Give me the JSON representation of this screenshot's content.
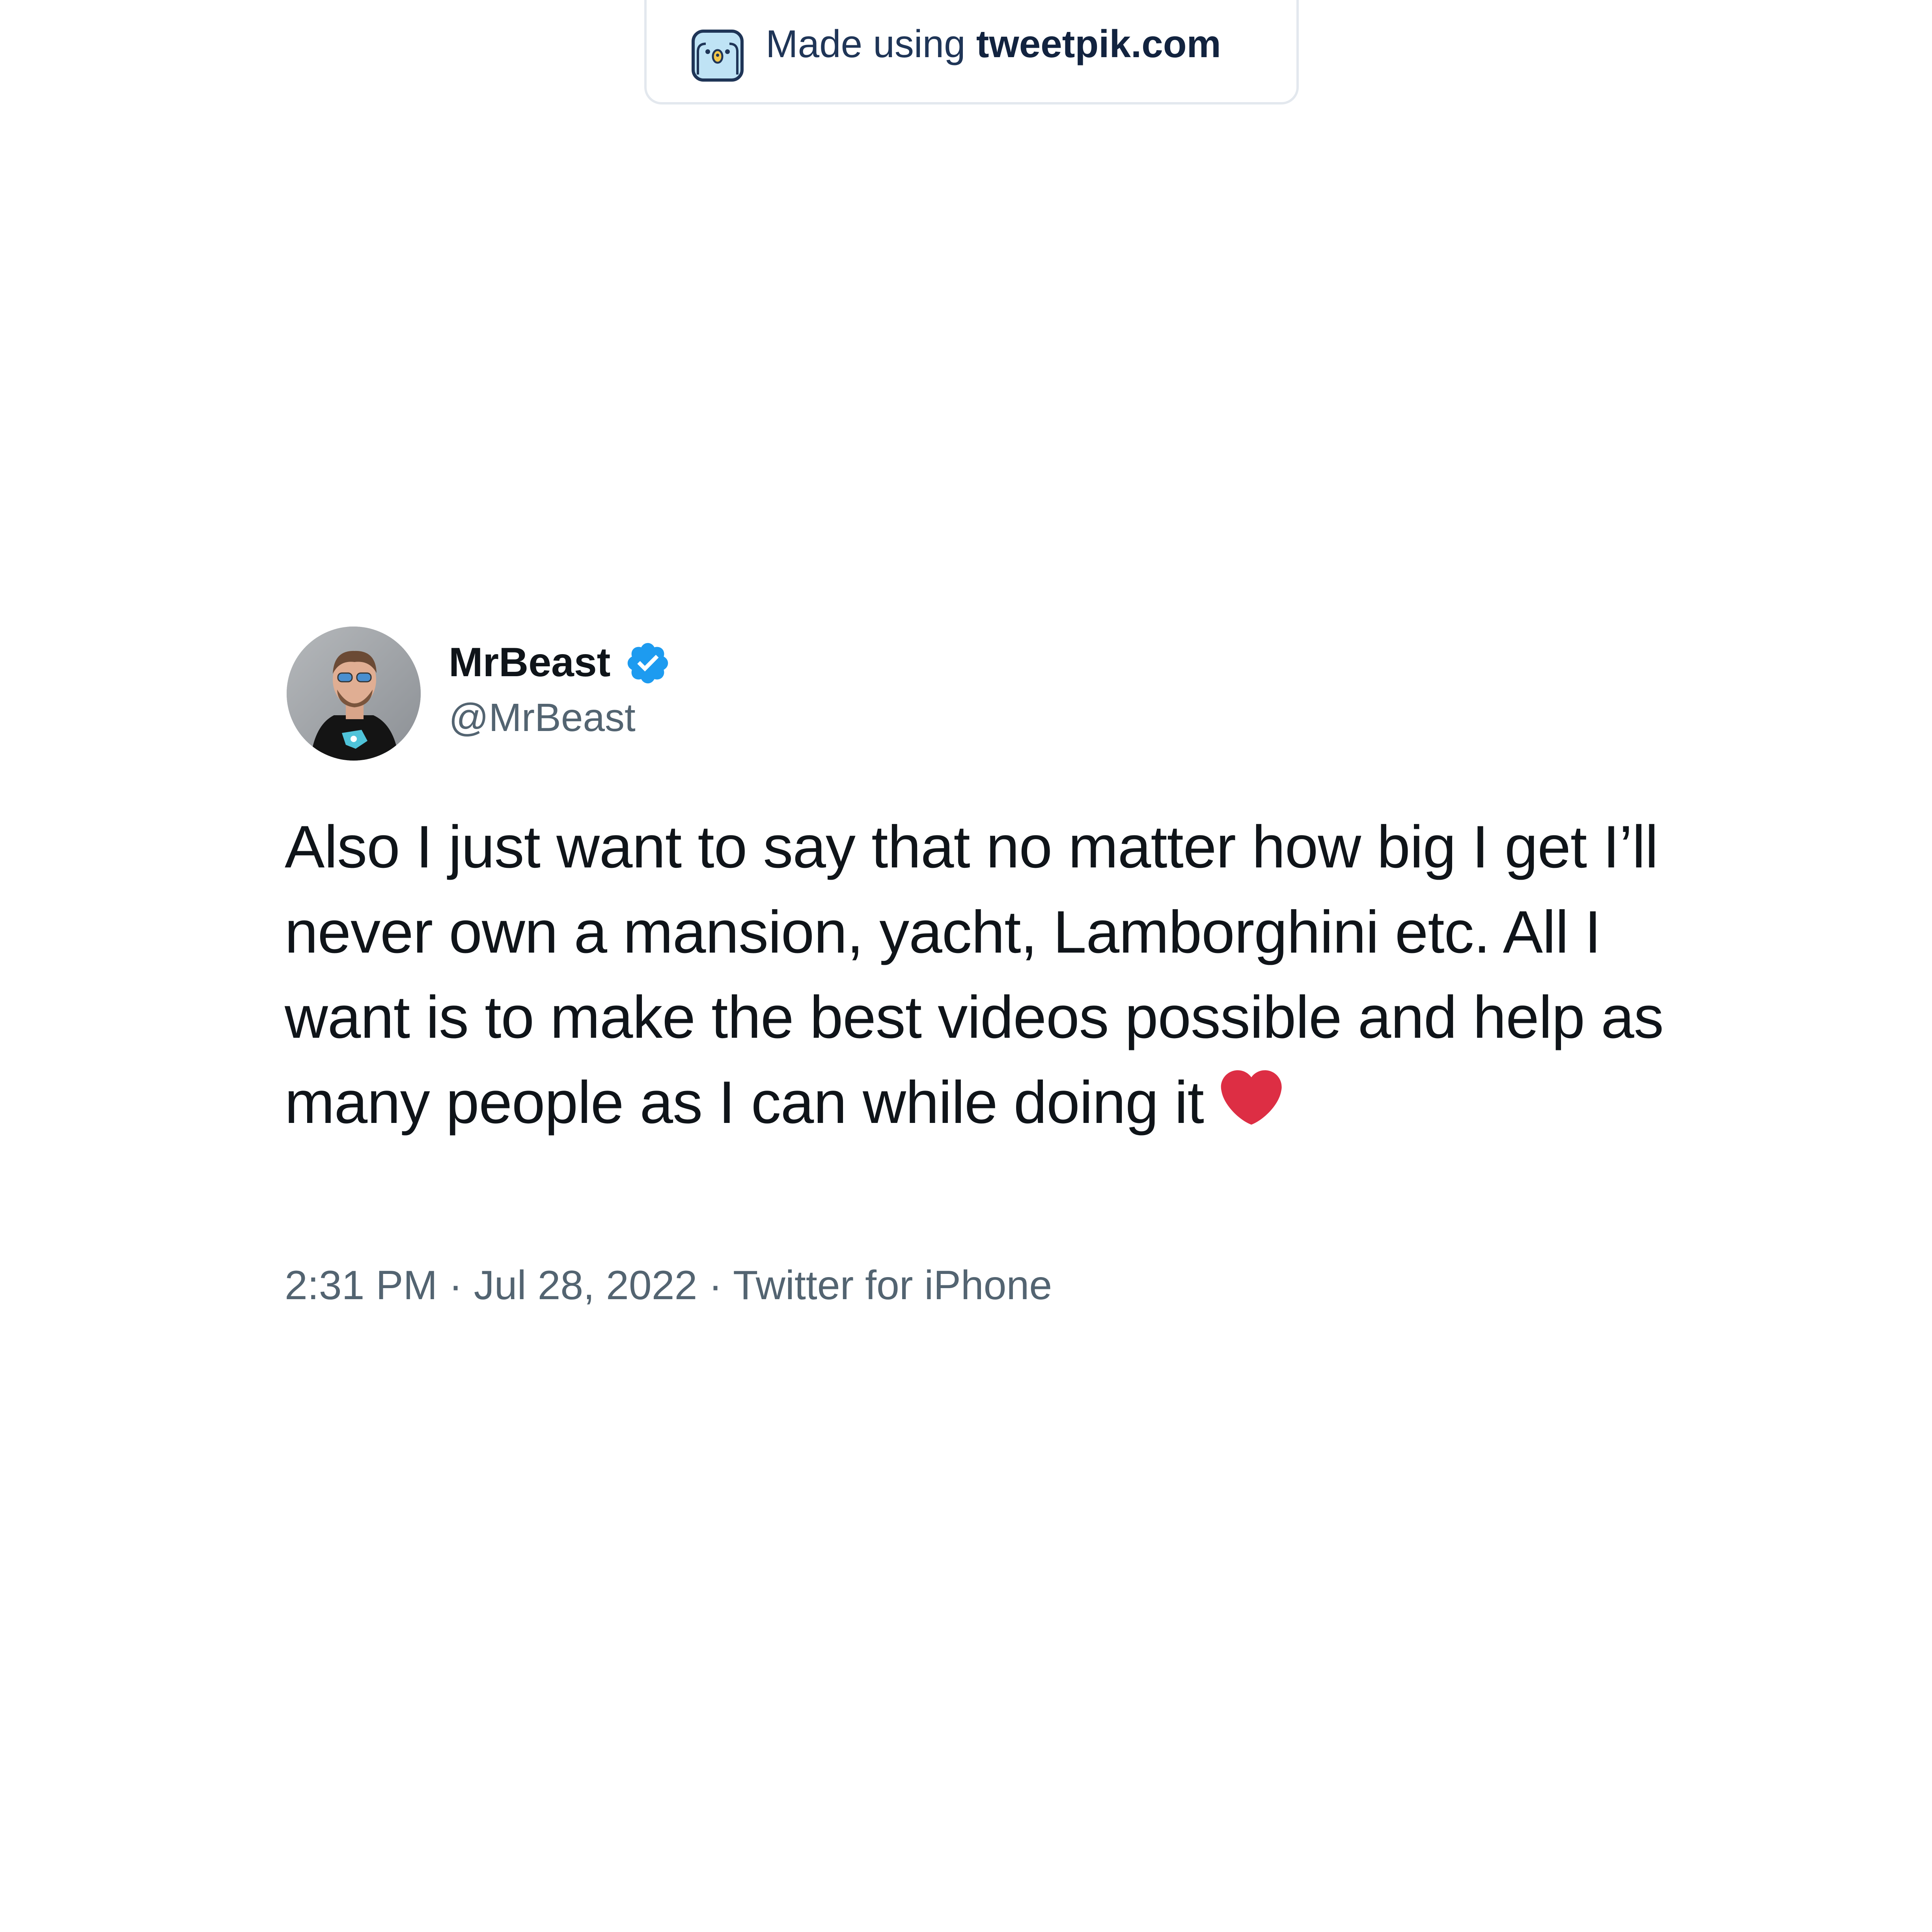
{
  "watermark": {
    "prefix": "Made using ",
    "brand": "tweetpik.com",
    "logo_icon": "tweetpik-bird-icon"
  },
  "tweet": {
    "display_name": "MrBeast",
    "handle": "@MrBeast",
    "verified_icon": "verified-badge-icon",
    "verified_color": "#1d9bf0",
    "text": "Also I just want to say that no matter how big I get I’ll never own a mansion, yacht, Lamborghini etc. All I want is to make the best videos possible and help as many people as I can while doing it",
    "emoji": "red-heart-icon",
    "time": "2:31 PM",
    "separator1": " · ",
    "date": "Jul 28, 2022",
    "separator2": " · ",
    "source": "Twitter for iPhone"
  },
  "colors": {
    "text_primary": "#0f1419",
    "text_secondary": "#536471",
    "heart": "#dd2e44",
    "background": "#ffffff"
  }
}
